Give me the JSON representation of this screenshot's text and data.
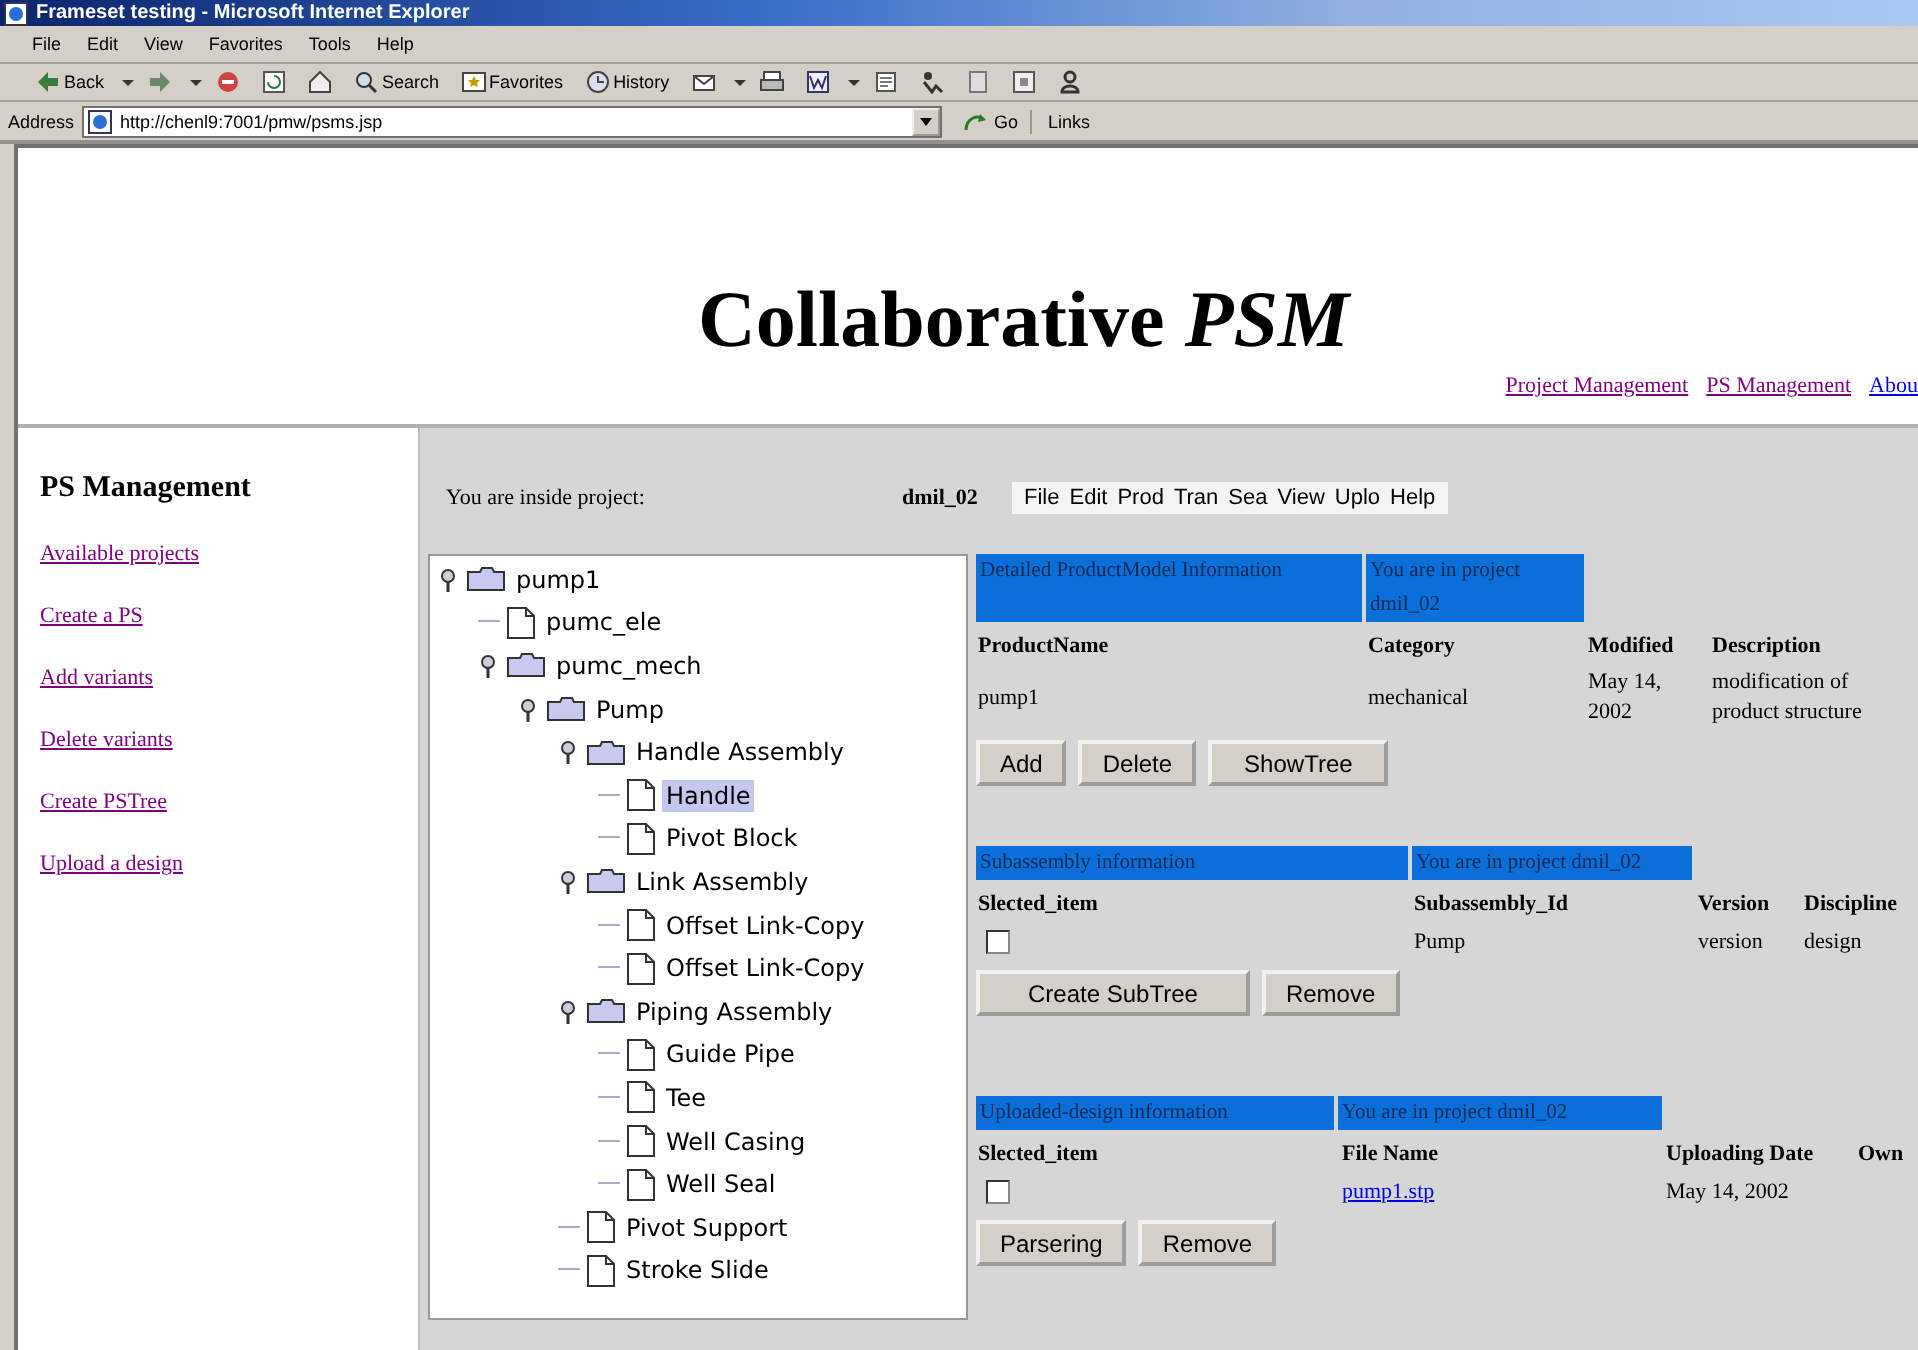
{
  "window": {
    "title": "Frameset testing - Microsoft Internet Explorer"
  },
  "menu_bar": [
    "File",
    "Edit",
    "View",
    "Favorites",
    "Tools",
    "Help"
  ],
  "toolbar": {
    "buttons": [
      "Back",
      "Search",
      "Favorites",
      "History"
    ]
  },
  "address_bar": {
    "label": "Address",
    "value": "http://chenl9:7001/pmw/psms.jsp",
    "go": "Go",
    "links": "Links"
  },
  "header": {
    "title": "Collaborative *PSM*",
    "links": [
      {
        "text": "Project Management",
        "visited": true
      },
      {
        "text": "PS Management",
        "visited": true
      },
      {
        "text": "Abou",
        "visited": false
      }
    ]
  },
  "sidebar": {
    "heading": "PS Management",
    "items": [
      {
        "text": "Available projects",
        "visited": true
      },
      {
        "text": "Create a PS",
        "visited": true
      },
      {
        "text": "Add variants",
        "visited": true
      },
      {
        "text": "Delete variants",
        "visited": true
      },
      {
        "text": "Create PSTree",
        "visited": true
      },
      {
        "text": "Upload a design",
        "visited": true
      }
    ]
  },
  "project_bar": {
    "label": "You are inside project:",
    "project": "dmil_02",
    "menu": [
      "File",
      "Edit",
      "Prod",
      "Tran",
      "Sea",
      "View",
      "Uplo",
      "Help"
    ]
  },
  "tree": [
    {
      "label": "pump1",
      "kind": "folder",
      "expanded": true,
      "selected": false,
      "children": [
        {
          "label": "pumc_ele",
          "kind": "leaf",
          "selected": false
        },
        {
          "label": "pumc_mech",
          "kind": "folder",
          "expanded": true,
          "selected": false,
          "children": [
            {
              "label": "Pump",
              "kind": "folder",
              "expanded": true,
              "selected": false,
              "children": [
                {
                  "label": "Handle Assembly",
                  "kind": "folder",
                  "expanded": true,
                  "selected": false,
                  "children": [
                    {
                      "label": "Handle",
                      "kind": "leaf",
                      "selected": true
                    },
                    {
                      "label": "Pivot Block",
                      "kind": "leaf",
                      "selected": false
                    }
                  ]
                },
                {
                  "label": "Link Assembly",
                  "kind": "folder",
                  "expanded": true,
                  "selected": false,
                  "children": [
                    {
                      "label": "Offset Link-Copy",
                      "kind": "leaf",
                      "selected": false
                    },
                    {
                      "label": "Offset Link-Copy",
                      "kind": "leaf",
                      "selected": false
                    }
                  ]
                },
                {
                  "label": "Piping Assembly",
                  "kind": "folder",
                  "expanded": true,
                  "selected": false,
                  "children": [
                    {
                      "label": "Guide Pipe",
                      "kind": "leaf",
                      "selected": false
                    },
                    {
                      "label": "Tee",
                      "kind": "leaf",
                      "selected": false
                    },
                    {
                      "label": "Well Casing",
                      "kind": "leaf",
                      "selected": false
                    },
                    {
                      "label": "Well Seal",
                      "kind": "leaf",
                      "selected": false
                    }
                  ]
                },
                {
                  "label": "Pivot Support",
                  "kind": "leaf",
                  "selected": false
                },
                {
                  "label": "Stroke Slide",
                  "kind": "leaf",
                  "selected": false
                }
              ]
            }
          ]
        }
      ]
    }
  ],
  "sections": [
    {
      "banner": [
        "Detailed ProductModel Information",
        "You are in project dmil_02"
      ],
      "columns": [
        "ProductName",
        "Category",
        "Modified",
        "Description"
      ],
      "rows": [
        {
          "cells": [
            {
              "kind": "text",
              "text": "pump1"
            },
            {
              "kind": "text",
              "text": "mechanical"
            },
            {
              "kind": "text",
              "text": "May 14, 2002"
            },
            {
              "kind": "text",
              "text": "modification of product structure"
            }
          ]
        }
      ],
      "buttons": [
        "Add",
        "Delete",
        "ShowTree"
      ]
    },
    {
      "banner": [
        "Subassembly information",
        "You are in project dmil_02"
      ],
      "columns": [
        "Slected_item",
        "Subassembly_Id",
        "Version",
        "Discipline"
      ],
      "rows": [
        {
          "cells": [
            {
              "kind": "checkbox",
              "checked": false
            },
            {
              "kind": "text",
              "text": "Pump"
            },
            {
              "kind": "text",
              "text": "version"
            },
            {
              "kind": "text",
              "text": "design"
            }
          ]
        }
      ],
      "buttons": [
        "Create SubTree",
        "Remove"
      ]
    },
    {
      "banner": [
        "Uploaded-design information",
        "You are in project dmil_02"
      ],
      "columns": [
        "Slected_item",
        "File Name",
        "Uploading Date",
        "Own"
      ],
      "rows": [
        {
          "cells": [
            {
              "kind": "checkbox",
              "checked": false
            },
            {
              "kind": "link",
              "text": "pump1.stp"
            },
            {
              "kind": "text",
              "text": "May 14, 2002"
            }
          ]
        }
      ],
      "buttons": [
        "Parsering",
        "Remove"
      ]
    }
  ]
}
